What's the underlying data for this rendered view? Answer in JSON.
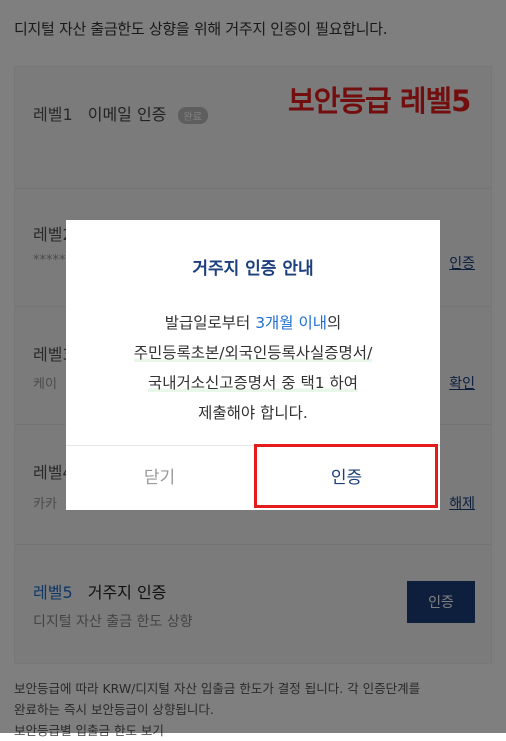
{
  "intro_text": "디지털 자산 출금한도 상향을 위해 거주지 인증이 필요합니다.",
  "levels": [
    {
      "level": "레벨1",
      "title": "이메일 인증",
      "badge": "완료",
      "subtitle": "",
      "action": ""
    },
    {
      "level": "레벨2",
      "title": "",
      "subtitle": "*****",
      "action": "인증"
    },
    {
      "level": "레벨3",
      "title": "",
      "subtitle": "케이",
      "action": "확인"
    },
    {
      "level": "레벨4",
      "title": "",
      "subtitle": "카카",
      "action": "해제"
    },
    {
      "level": "레벨5",
      "title": "거주지 인증",
      "subtitle": "디지털 자산 출금 한도 상향",
      "action": "인증"
    }
  ],
  "footer_lines": [
    "보안등급에 따라 KRW/디지털 자산 입출금 한도가 결정 됩니다. 각 인증단계를",
    "완료하는 즉시 보안등급이 상향됩니다.",
    "보안등급별 입출금 한도 보기"
  ],
  "annotation": "보안등급 레벨5",
  "modal": {
    "title": "거주지 인증 안내",
    "body_line1_prefix": "발급일로부터 ",
    "body_line1_highlight": "3개월 이내",
    "body_line1_suffix": "의",
    "body_line2": "주민등록초본/외국인등록사실증명서/",
    "body_line3": "국내거소신고증명서 중 택1 하여",
    "body_line4": "제출해야 합니다.",
    "close_label": "닫기",
    "confirm_label": "인증"
  },
  "colors": {
    "accent": "#1c3f7d",
    "highlight_blue": "#1f6fd0",
    "annotation_red": "#e51c1c",
    "overlay": "rgba(0,0,0,0.5)"
  }
}
